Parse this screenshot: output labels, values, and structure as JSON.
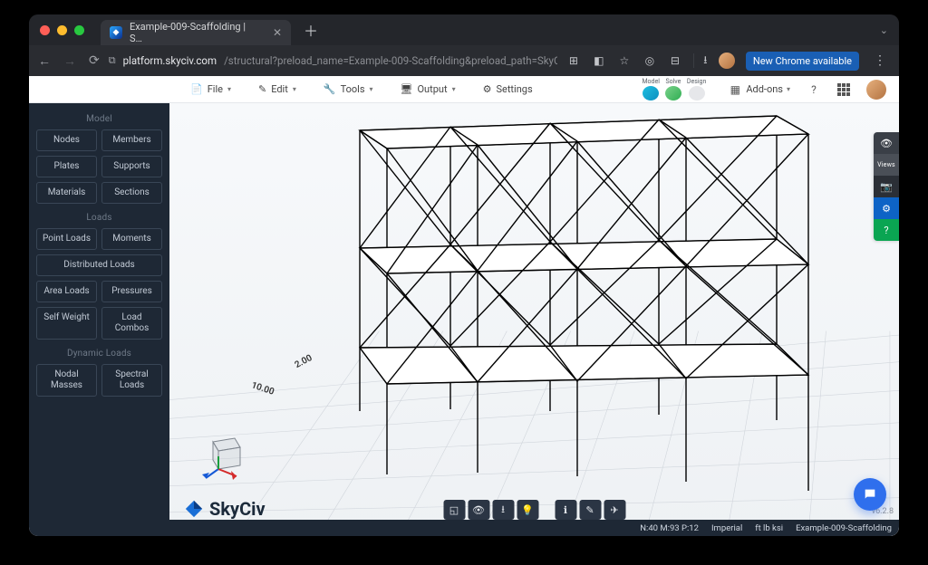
{
  "browser": {
    "tab_title": "Example-009-Scaffolding | S…",
    "url_host": "platform.skyciv.com",
    "url_path": "/structural?preload_name=Example-009-Scaffolding&preload_path=SkyCiv%20Team%20Folder/Examples%20a…",
    "chrome_pill": "New Chrome available"
  },
  "toolbar": {
    "file": "File",
    "edit": "Edit",
    "tools": "Tools",
    "output": "Output",
    "settings": "Settings",
    "mini": {
      "model": "Model",
      "solve": "Solve",
      "design": "Design"
    },
    "addons": "Add-ons"
  },
  "sidebar": {
    "sections": {
      "model": {
        "title": "Model",
        "items": [
          "Nodes",
          "Members",
          "Plates",
          "Supports",
          "Materials",
          "Sections"
        ]
      },
      "loads": {
        "title": "Loads",
        "items": [
          "Point Loads",
          "Moments",
          "Distributed Loads",
          "Area Loads",
          "Pressures",
          "Self Weight",
          "Load Combos"
        ]
      },
      "dynamic": {
        "title": "Dynamic Loads",
        "items": [
          "Nodal Masses",
          "Spectral Loads"
        ]
      }
    }
  },
  "canvas": {
    "brand": "SkyCiv",
    "dim_a": "2.00",
    "dim_b": "10.00",
    "version": "v6.2.8"
  },
  "right_rail": {
    "views_label": "Views"
  },
  "status": {
    "counts": "N:40  M:93  P:12",
    "system": "Imperial",
    "units": "ft  lb  ksi",
    "filename": "Example-009-Scaffolding"
  }
}
